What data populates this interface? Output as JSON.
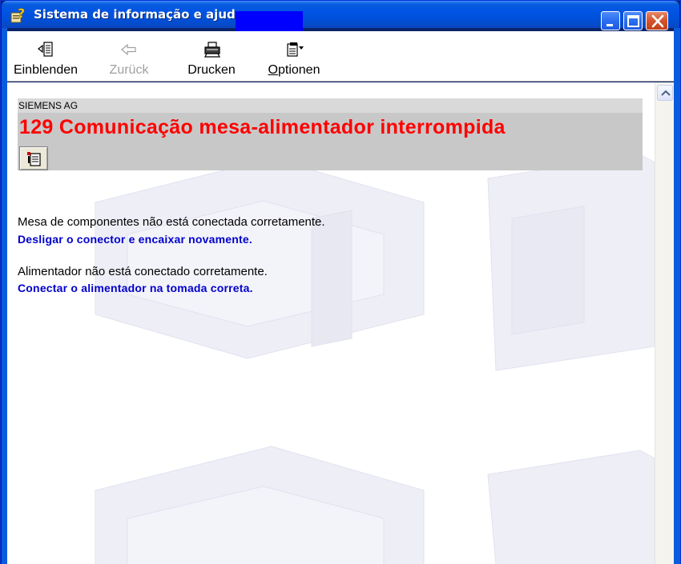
{
  "window": {
    "title": "Sistema de informação e ajuda",
    "minimize_label": "",
    "maximize_label": "",
    "close_label": ""
  },
  "toolbar": {
    "show_label": "Einblenden",
    "back_label": "Zurück",
    "print_label": "Drucken",
    "options_label_first": "O",
    "options_label_rest": "ptionen"
  },
  "content": {
    "company": "SIEMENS AG",
    "error_title": "129  Comunicação mesa-alimentador interrompida",
    "issues": [
      {
        "problem": "Mesa de componentes não está conectada corretamente.",
        "solution": "Desligar o conector e encaixar novamente."
      },
      {
        "problem": "Alimentador não está conectado corretamente.",
        "solution": "Conectar o alimentador na tomada correta."
      }
    ]
  },
  "colors": {
    "title_bar": "#0054e3",
    "error_title": "#ff0000",
    "solution_text": "#0000cc",
    "header_panel": "#c8c8c8"
  },
  "icons": {
    "title": "help-question-icon",
    "show": "show-pane-icon",
    "back": "back-arrow-icon",
    "print": "printer-icon",
    "options": "options-icon",
    "page": "page-tools-icon"
  }
}
